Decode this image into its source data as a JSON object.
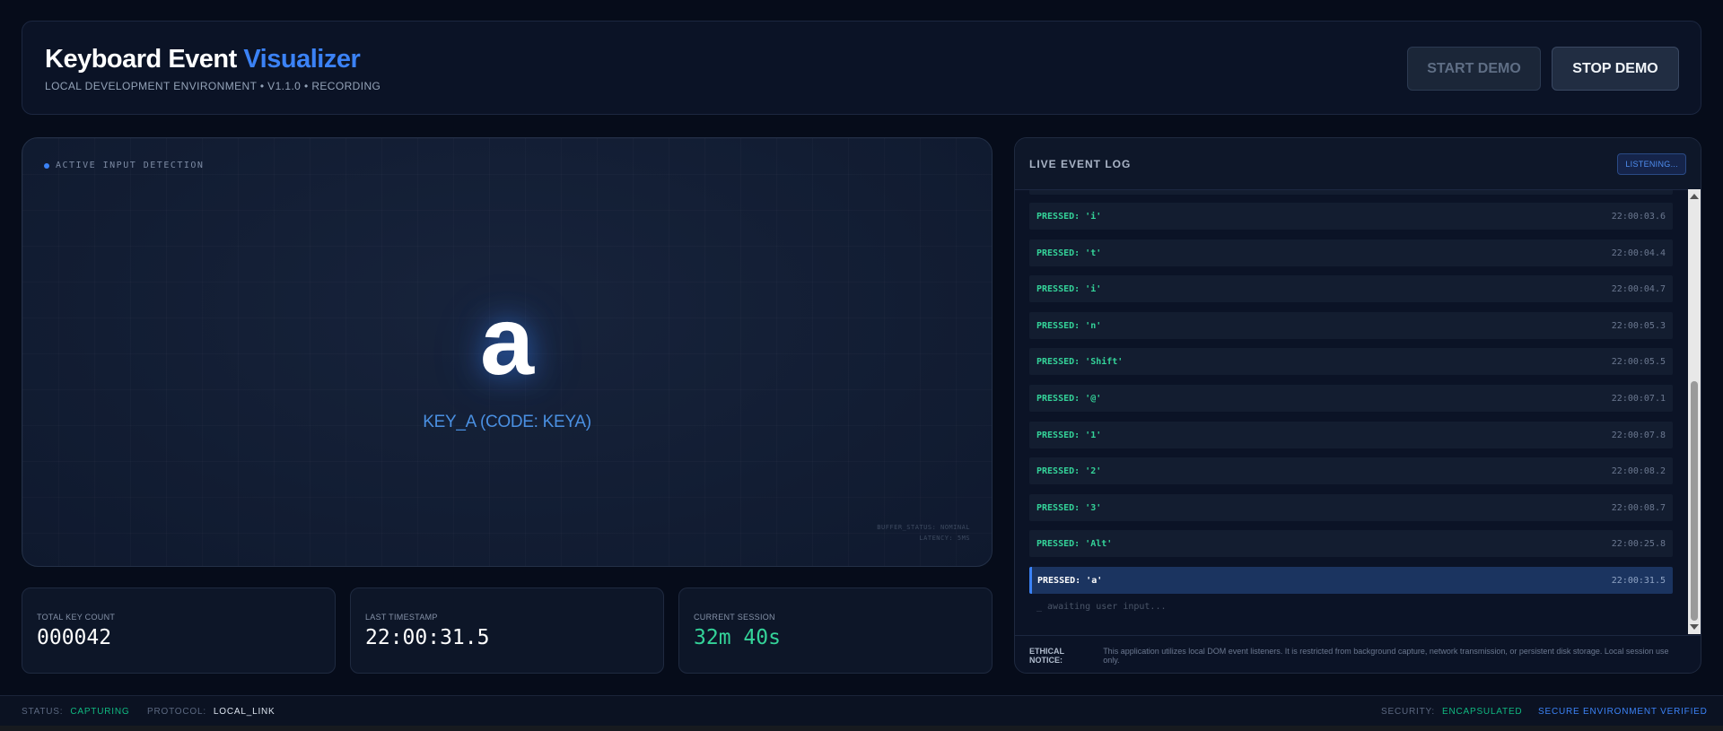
{
  "header": {
    "title_main": "Keyboard Event",
    "title_accent": "Visualizer",
    "subtitle": "LOCAL DEVELOPMENT ENVIRONMENT • V1.1.0 • RECORDING",
    "start_label": "START DEMO",
    "stop_label": "STOP DEMO"
  },
  "visualizer": {
    "detection_label": "ACTIVE INPUT DETECTION",
    "current_key": "a",
    "key_code": "KEY_A (CODE: KEYA)",
    "buffer_status": "BUFFER_STATUS: NOMINAL",
    "latency": "LATENCY: 5MS"
  },
  "stats": {
    "total_label": "TOTAL KEY COUNT",
    "total_value": "000042",
    "timestamp_label": "LAST TIMESTAMP",
    "timestamp_value": "22:00:31.5",
    "session_label": "CURRENT SESSION",
    "session_value": "32m 40s"
  },
  "log": {
    "title": "LIVE EVENT LOG",
    "listening_label": "LISTENING...",
    "entries": [
      {
        "key": "PRESSED: 'i'",
        "time": "22:00:03.6"
      },
      {
        "key": "PRESSED: 't'",
        "time": "22:00:04.4"
      },
      {
        "key": "PRESSED: 'i'",
        "time": "22:00:04.7"
      },
      {
        "key": "PRESSED: 'n'",
        "time": "22:00:05.3"
      },
      {
        "key": "PRESSED: 'Shift'",
        "time": "22:00:05.5"
      },
      {
        "key": "PRESSED: '@'",
        "time": "22:00:07.1"
      },
      {
        "key": "PRESSED: '1'",
        "time": "22:00:07.8"
      },
      {
        "key": "PRESSED: '2'",
        "time": "22:00:08.2"
      },
      {
        "key": "PRESSED: '3'",
        "time": "22:00:08.7"
      },
      {
        "key": "PRESSED: 'Alt'",
        "time": "22:00:25.8"
      },
      {
        "key": "PRESSED: 'a'",
        "time": "22:00:31.5"
      }
    ],
    "awaiting": "_ awaiting user input...",
    "notice_label": "ETHICAL NOTICE:",
    "notice_text": "This application utilizes local DOM event listeners. It is restricted from background capture, network transmission, or persistent disk storage. Local session use only."
  },
  "footer": {
    "status_label": "STATUS:",
    "status_value": "CAPTURING",
    "protocol_label": "PROTOCOL:",
    "protocol_value": "LOCAL_LINK",
    "security_label": "SECURITY:",
    "security_value": "ENCAPSULATED",
    "verified": "SECURE ENVIRONMENT VERIFIED"
  },
  "colors": {
    "accent": "#3b82f6",
    "success": "#34d399",
    "background": "#060c1a"
  }
}
